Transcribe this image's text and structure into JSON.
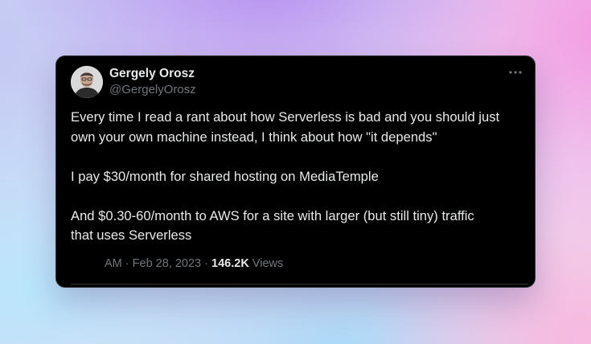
{
  "tweet": {
    "author_name": "Gergely Orosz",
    "author_handle": "@GergelyOrosz",
    "paragraphs": [
      "Every time I read a rant about how Serverless is bad and you should just\nown your own machine instead, I think about how \"it depends\"",
      "I pay $30/month for shared hosting on MediaTemple",
      "And $0.30-60/month to AWS for a site with larger (but still tiny) traffic\nthat uses Serverless"
    ],
    "time": "AM",
    "separator": "·",
    "date": "Feb 28, 2023",
    "views_count": "146.2K",
    "views_label": "Views"
  },
  "icons": {
    "more": "more-horizontal-icon",
    "avatar": "user-avatar"
  },
  "colors": {
    "card_background": "#000000",
    "primary_text": "#e7e9ea",
    "secondary_text": "#71767b",
    "border": "#2f3336"
  }
}
